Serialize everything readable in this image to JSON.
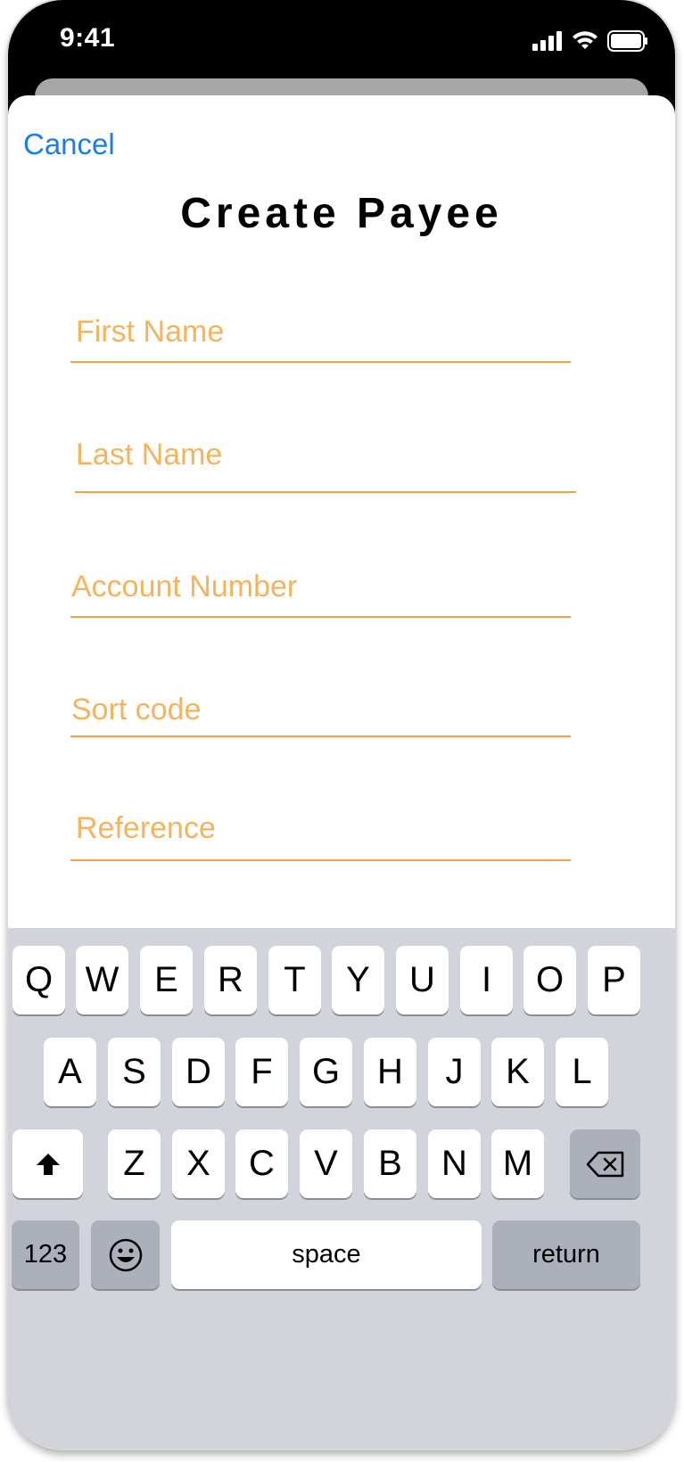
{
  "status_bar": {
    "time": "9:41",
    "icons": [
      "signal-icon",
      "wifi-icon",
      "battery-icon"
    ]
  },
  "header": {
    "cancel_label": "Cancel",
    "title": "Create Payee"
  },
  "form": {
    "first_name_placeholder": "First Name",
    "last_name_placeholder": "Last Name",
    "account_number_placeholder": "Account Number",
    "sort_code_placeholder": "Sort code",
    "reference_placeholder": "Reference"
  },
  "keyboard": {
    "row1": [
      "Q",
      "W",
      "E",
      "R",
      "T",
      "Y",
      "U",
      "I",
      "O",
      "P"
    ],
    "row2": [
      "A",
      "S",
      "D",
      "F",
      "G",
      "H",
      "J",
      "K",
      "L"
    ],
    "row3": [
      "Z",
      "X",
      "C",
      "V",
      "B",
      "N",
      "M"
    ],
    "numbers_label": "123",
    "space_label": "space",
    "return_label": "return",
    "icons": [
      "shift-icon",
      "delete-icon",
      "emoji-icon"
    ]
  },
  "colors": {
    "accent": "#f0a53a",
    "placeholder": "#f7b25c",
    "link": "#1a7cf0",
    "keyboard_bg": "#d1d4da"
  }
}
